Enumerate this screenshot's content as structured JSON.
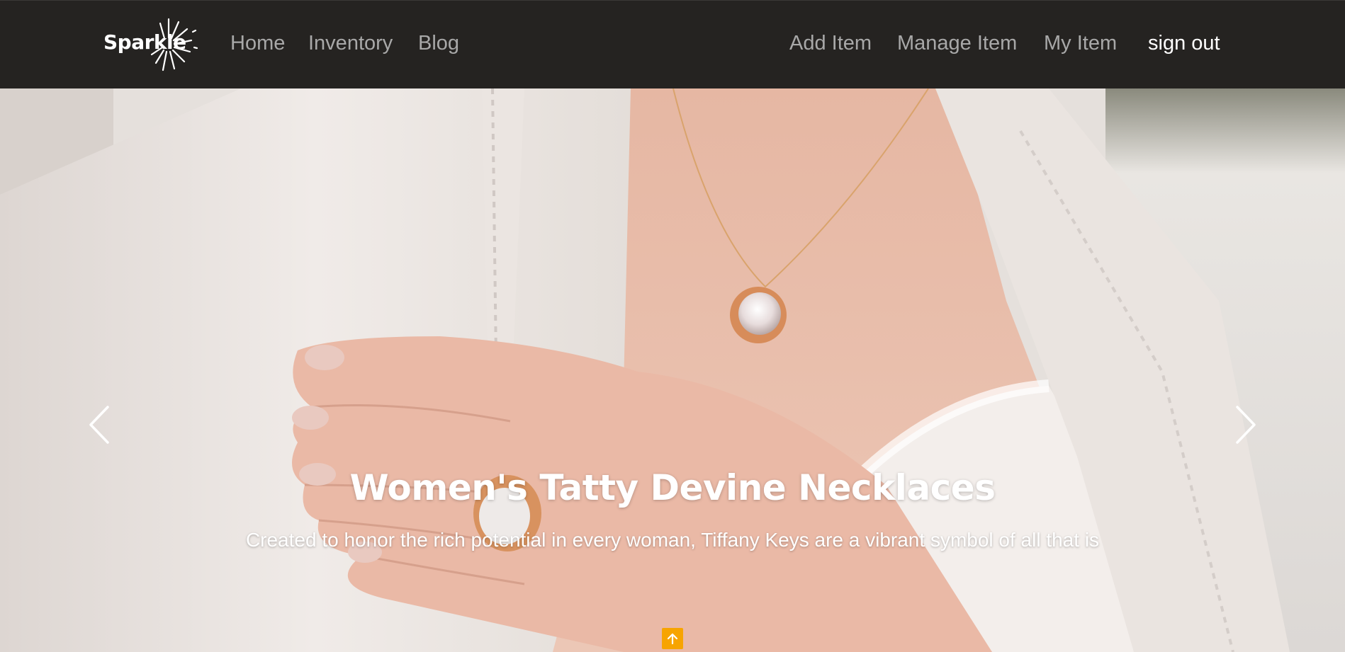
{
  "brand": {
    "name": "Sparkle"
  },
  "nav": {
    "left": [
      {
        "label": "Home"
      },
      {
        "label": "Inventory"
      },
      {
        "label": "Blog"
      }
    ],
    "right": [
      {
        "label": "Add Item"
      },
      {
        "label": "Manage Item"
      },
      {
        "label": "My Item"
      },
      {
        "label": "sign out"
      }
    ]
  },
  "hero": {
    "title": "Women's Tatty Devine Necklaces",
    "text": "Created to honor the rich potential in every woman, Tiffany Keys are a vibrant symbol of all that is"
  },
  "icons": {
    "prev": "chevron-left-icon",
    "next": "chevron-right-icon",
    "scroll_top": "arrow-up-icon"
  },
  "colors": {
    "navbar_bg": "#252321",
    "nav_link": "#a8a8a8",
    "nav_active": "#ffffff",
    "scroll_top_bg": "#f7a400"
  }
}
